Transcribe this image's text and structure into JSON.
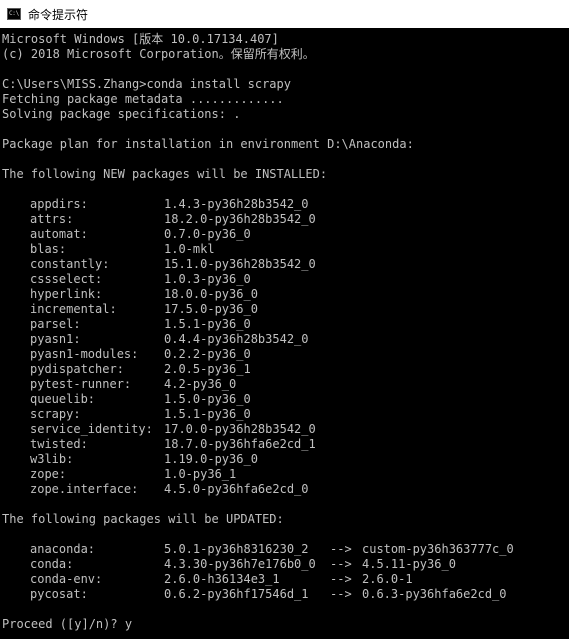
{
  "window": {
    "title": "命令提示符",
    "icon_glyph": "C:\\"
  },
  "console": {
    "header": [
      "Microsoft Windows [版本 10.0.17134.407]",
      "(c) 2018 Microsoft Corporation。保留所有权利。"
    ],
    "command": "C:\\Users\\MISS.Zhang>conda install scrapy",
    "fetching": "Fetching package metadata .............",
    "solving": "Solving package specifications: .",
    "plan": "Package plan for installation in environment D:\\Anaconda:",
    "new_heading": "The following NEW packages will be INSTALLED:",
    "new_packages": [
      {
        "name": "appdirs:",
        "version": "1.4.3-py36h28b3542_0"
      },
      {
        "name": "attrs:",
        "version": "18.2.0-py36h28b3542_0"
      },
      {
        "name": "automat:",
        "version": "0.7.0-py36_0"
      },
      {
        "name": "blas:",
        "version": "1.0-mkl"
      },
      {
        "name": "constantly:",
        "version": "15.1.0-py36h28b3542_0"
      },
      {
        "name": "cssselect:",
        "version": "1.0.3-py36_0"
      },
      {
        "name": "hyperlink:",
        "version": "18.0.0-py36_0"
      },
      {
        "name": "incremental:",
        "version": "17.5.0-py36_0"
      },
      {
        "name": "parsel:",
        "version": "1.5.1-py36_0"
      },
      {
        "name": "pyasn1:",
        "version": "0.4.4-py36h28b3542_0"
      },
      {
        "name": "pyasn1-modules:",
        "version": "0.2.2-py36_0"
      },
      {
        "name": "pydispatcher:",
        "version": "2.0.5-py36_1"
      },
      {
        "name": "pytest-runner:",
        "version": "4.2-py36_0"
      },
      {
        "name": "queuelib:",
        "version": "1.5.0-py36_0"
      },
      {
        "name": "scrapy:",
        "version": "1.5.1-py36_0"
      },
      {
        "name": "service_identity:",
        "version": "17.0.0-py36h28b3542_0"
      },
      {
        "name": "twisted:",
        "version": "18.7.0-py36hfa6e2cd_1"
      },
      {
        "name": "w3lib:",
        "version": "1.19.0-py36_0"
      },
      {
        "name": "zope:",
        "version": "1.0-py36_1"
      },
      {
        "name": "zope.interface:",
        "version": "4.5.0-py36hfa6e2cd_0"
      }
    ],
    "updated_heading": "The following packages will be UPDATED:",
    "updated_packages": [
      {
        "name": "anaconda:",
        "from": "5.0.1-py36h8316230_2",
        "arrow": "-->",
        "to": "custom-py36h363777c_0"
      },
      {
        "name": "conda:",
        "from": "4.3.30-py36h7e176b0_0",
        "arrow": "-->",
        "to": "4.5.11-py36_0"
      },
      {
        "name": "conda-env:",
        "from": "2.6.0-h36134e3_1",
        "arrow": "-->",
        "to": "2.6.0-1"
      },
      {
        "name": "pycosat:",
        "from": "0.6.2-py36hf17546d_1",
        "arrow": "-->",
        "to": "0.6.3-py36hfa6e2cd_0"
      }
    ],
    "prompt": "Proceed ([y]/n)? y"
  },
  "colors": {
    "console_background": "#000000",
    "console_text": "#c0c0c0",
    "titlebar_background": "#ffffff"
  }
}
